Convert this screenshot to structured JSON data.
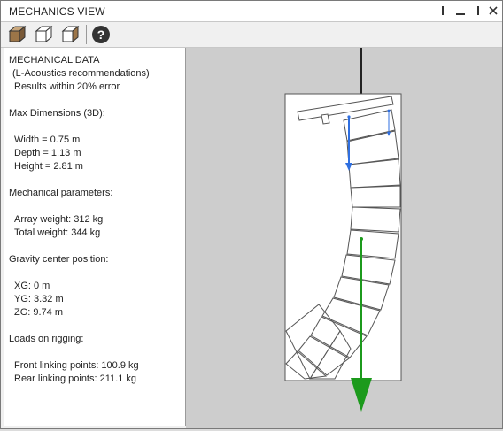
{
  "window": {
    "title": "MECHANICS VIEW"
  },
  "toolbar": {
    "buttons": [
      {
        "name": "view-3d-front-button",
        "icon": "cube-shaded-icon"
      },
      {
        "name": "view-3d-top-button",
        "icon": "cube-outline-icon"
      },
      {
        "name": "view-3d-side-button",
        "icon": "cube-outline-icon"
      },
      {
        "name": "help-button",
        "icon": "question-icon",
        "symbol": "?"
      }
    ]
  },
  "panel": {
    "header": "MECHANICAL DATA",
    "subtitle": "(L-Acoustics recommendations)",
    "accuracy": "Results within 20% error",
    "dimensions": {
      "heading": "Max Dimensions (3D):",
      "width": "Width = 0.75 m",
      "depth": "Depth = 1.13 m",
      "height": "Height = 2.81 m"
    },
    "mechanical": {
      "heading": "Mechanical parameters:",
      "array_weight": "Array weight: 312 kg",
      "total_weight": "Total weight: 344 kg"
    },
    "gravity": {
      "heading": "Gravity center position:",
      "xg": "XG: 0 m",
      "yg": "YG: 3.32 m",
      "zg": "ZG: 9.74 m"
    },
    "loads": {
      "heading": "Loads on rigging:",
      "front": "Front linking points: 100.9 kg",
      "rear": "Rear linking points: 211.1 kg"
    }
  },
  "colors": {
    "front_load_arrow": "#2f6fe0",
    "gravity_arrow": "#1c9a1c",
    "viewport_bg": "#cdcdcd",
    "enclosure_fill": "#ffffff"
  }
}
